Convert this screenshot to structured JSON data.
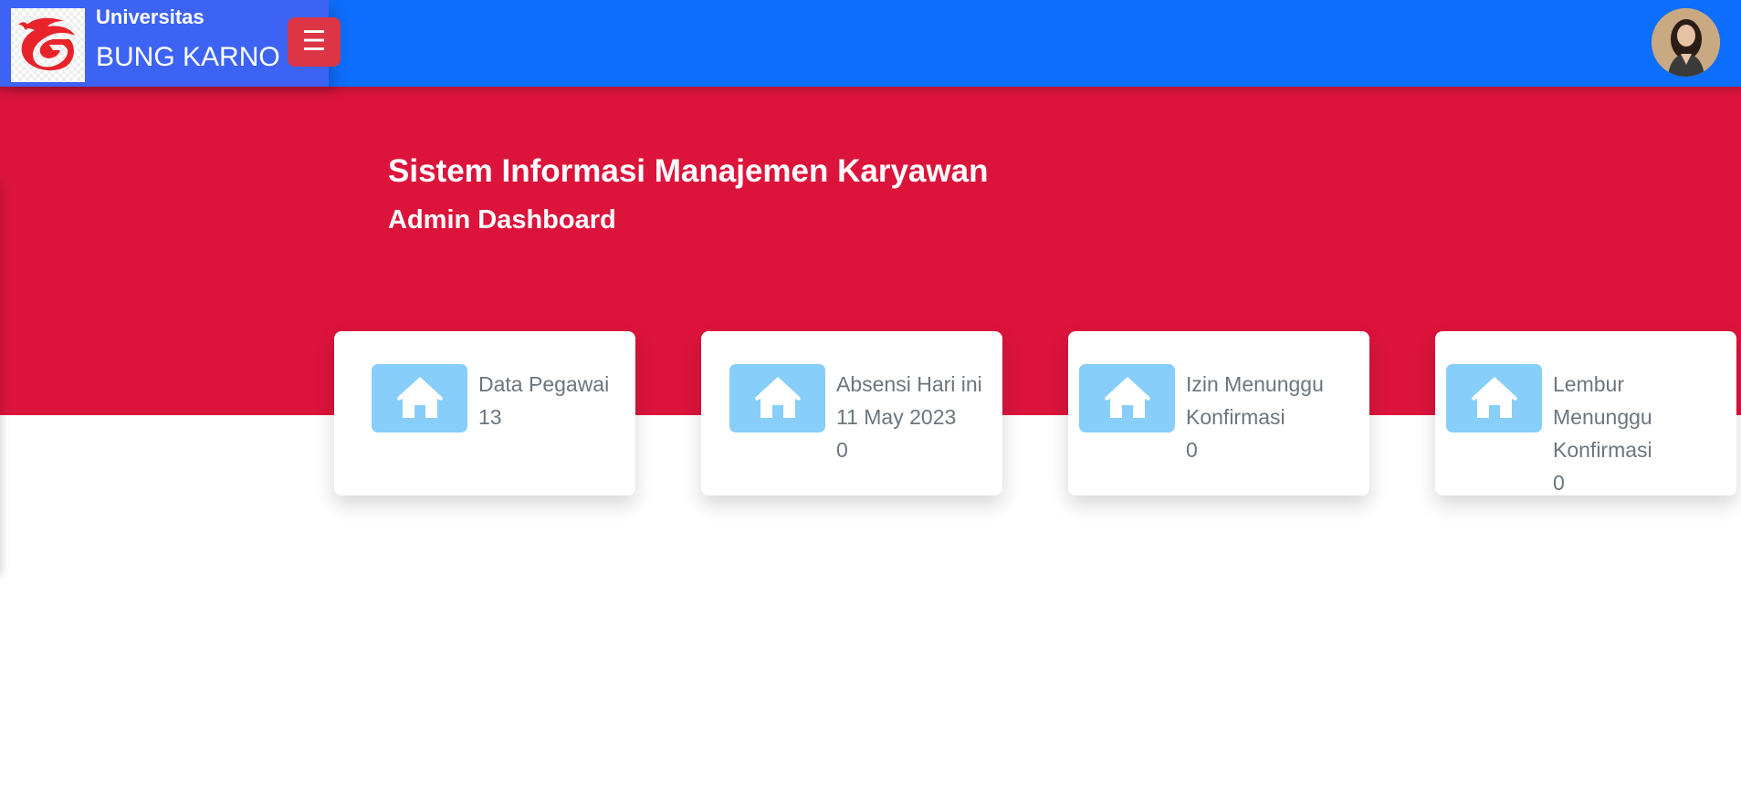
{
  "brand": {
    "line1": "Universitas",
    "line2": "BUNG KARNO",
    "logo_icon": "dragon-g-logo",
    "logo_color": "#e8232a"
  },
  "header": {
    "menu_icon": "hamburger-icon",
    "menu_glyph": "☰",
    "avatar": "user-avatar"
  },
  "hero": {
    "title": "Sistem Informasi Manajemen Karyawan",
    "subtitle": "Admin Dashboard"
  },
  "colors": {
    "topbar": "#0d6efd",
    "brand_panel": "#3d63f5",
    "hero": "#dc143c",
    "menu_button": "#dc3545",
    "card_icon_bg": "#87cefa",
    "card_text": "#6c757d"
  },
  "cards": [
    {
      "icon": "home-icon",
      "line1": "Data Pegawai",
      "line2": "13"
    },
    {
      "icon": "home-icon",
      "line1": "Absensi Hari ini",
      "line2": "11 May 2023",
      "line3": "0"
    },
    {
      "icon": "home-icon",
      "line1": "Izin Menunggu",
      "line2": "Konfirmasi",
      "line3": "0"
    },
    {
      "icon": "home-icon",
      "line1": "Lembur",
      "line2": "Menunggu",
      "line3": "Konfirmasi",
      "line4": "0"
    }
  ]
}
